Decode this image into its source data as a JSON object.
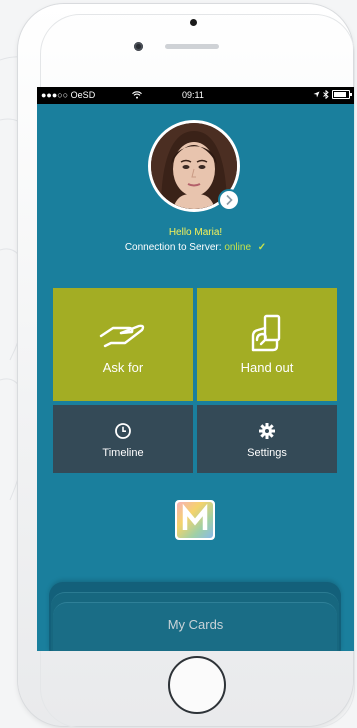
{
  "status_bar": {
    "carrier": "●●●○○ OeSD",
    "time": "09:11"
  },
  "profile": {
    "greeting": "Hello Maria!",
    "connection_label": "Connection to Server:",
    "connection_status": "online"
  },
  "tiles": {
    "ask_for": "Ask for",
    "hand_out": "Hand out",
    "timeline": "Timeline",
    "settings": "Settings"
  },
  "bottom_panel": {
    "label": "My Cards"
  },
  "colors": {
    "screen_bg": "#1a7f9d",
    "green_tile": "#a3ad24",
    "dark_tile": "#344a57",
    "greeting": "#f3f25a",
    "online": "#c7e24a"
  }
}
